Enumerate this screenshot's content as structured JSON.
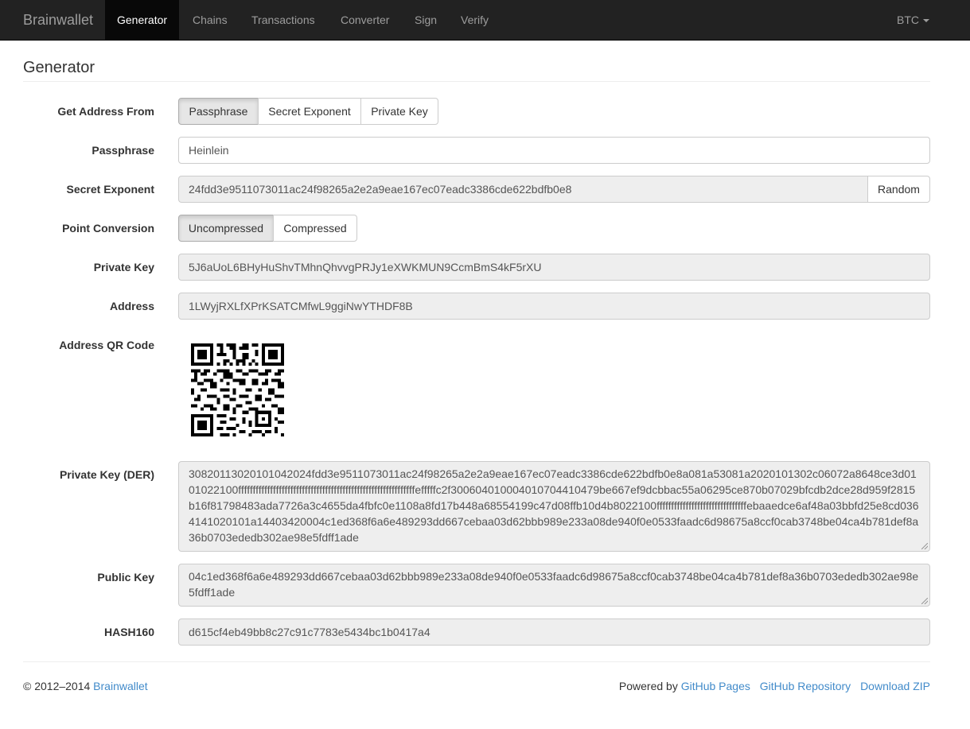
{
  "nav": {
    "brand": "Brainwallet",
    "items": [
      "Generator",
      "Chains",
      "Transactions",
      "Converter",
      "Sign",
      "Verify"
    ],
    "active": "Generator",
    "currency": "BTC"
  },
  "page": {
    "title": "Generator"
  },
  "form": {
    "get_address_from": {
      "label": "Get Address From",
      "options": [
        "Passphrase",
        "Secret Exponent",
        "Private Key"
      ],
      "selected": "Passphrase"
    },
    "passphrase": {
      "label": "Passphrase",
      "value": "Heinlein"
    },
    "secret_exponent": {
      "label": "Secret Exponent",
      "value": "24fdd3e9511073011ac24f98265a2e2a9eae167ec07eadc3386cde622bdfb0e8",
      "random_label": "Random"
    },
    "point_conversion": {
      "label": "Point Conversion",
      "options": [
        "Uncompressed",
        "Compressed"
      ],
      "selected": "Uncompressed"
    },
    "private_key": {
      "label": "Private Key",
      "value": "5J6aUoL6BHyHuShvTMhnQhvvgPRJy1eXWKMUN9CcmBmS4kF5rXU"
    },
    "address": {
      "label": "Address",
      "value": "1LWyjRXLfXPrKSATCMfwL9ggiNwYTHDF8B"
    },
    "qr": {
      "label": "Address QR Code"
    },
    "private_key_der": {
      "label": "Private Key (DER)",
      "value": "3082011302010104202 4fdd3e9511073011ac24f98265a2e2a9eae167ec07eadc3386cde622bdfb0e8a081a53081a2020101302c06072a8648ce3d0101022100fffffffffffffffffffffffffffffffffffffffffffffffffffffffffffffefffffc2f300604010004010704410479be667ef9dcbbac55a06295ce870b07029bfcdb2dce28d959f2815b16f81798483ada7726a3c4655da4fbfc0e1108a8fd17b448a68554199c47d08ffb10d4b8022100fffffffffffffffffffffffffffffffebaaedce6af48a03bbfd25e8cd0364141020101a14403420004c1ed368f6a6e489293dd667cebaa03d62bbb989e233a08de940f0e0533faadc6d98675a8ccf0cab3748be04ca4b781def8a36b0703ededb302ae98e5fdff1ade"
    },
    "public_key": {
      "label": "Public Key",
      "value": "04c1ed368f6a6e489293dd667cebaa03d62bbb989e233a08de940f0e0533faadc6d98675a8ccf0cab3748be04ca4b781def8a36b0703ededb302ae98e5fdff1ade"
    },
    "hash160": {
      "label": "HASH160",
      "value": "d615cf4eb49bb8c27c91c7783e5434bc1b0417a4"
    }
  },
  "footer": {
    "copyright": "© 2012–2014",
    "copyright_link": "Brainwallet",
    "powered_by": "Powered by",
    "links": [
      "GitHub Pages",
      "GitHub Repository",
      "Download ZIP"
    ]
  }
}
